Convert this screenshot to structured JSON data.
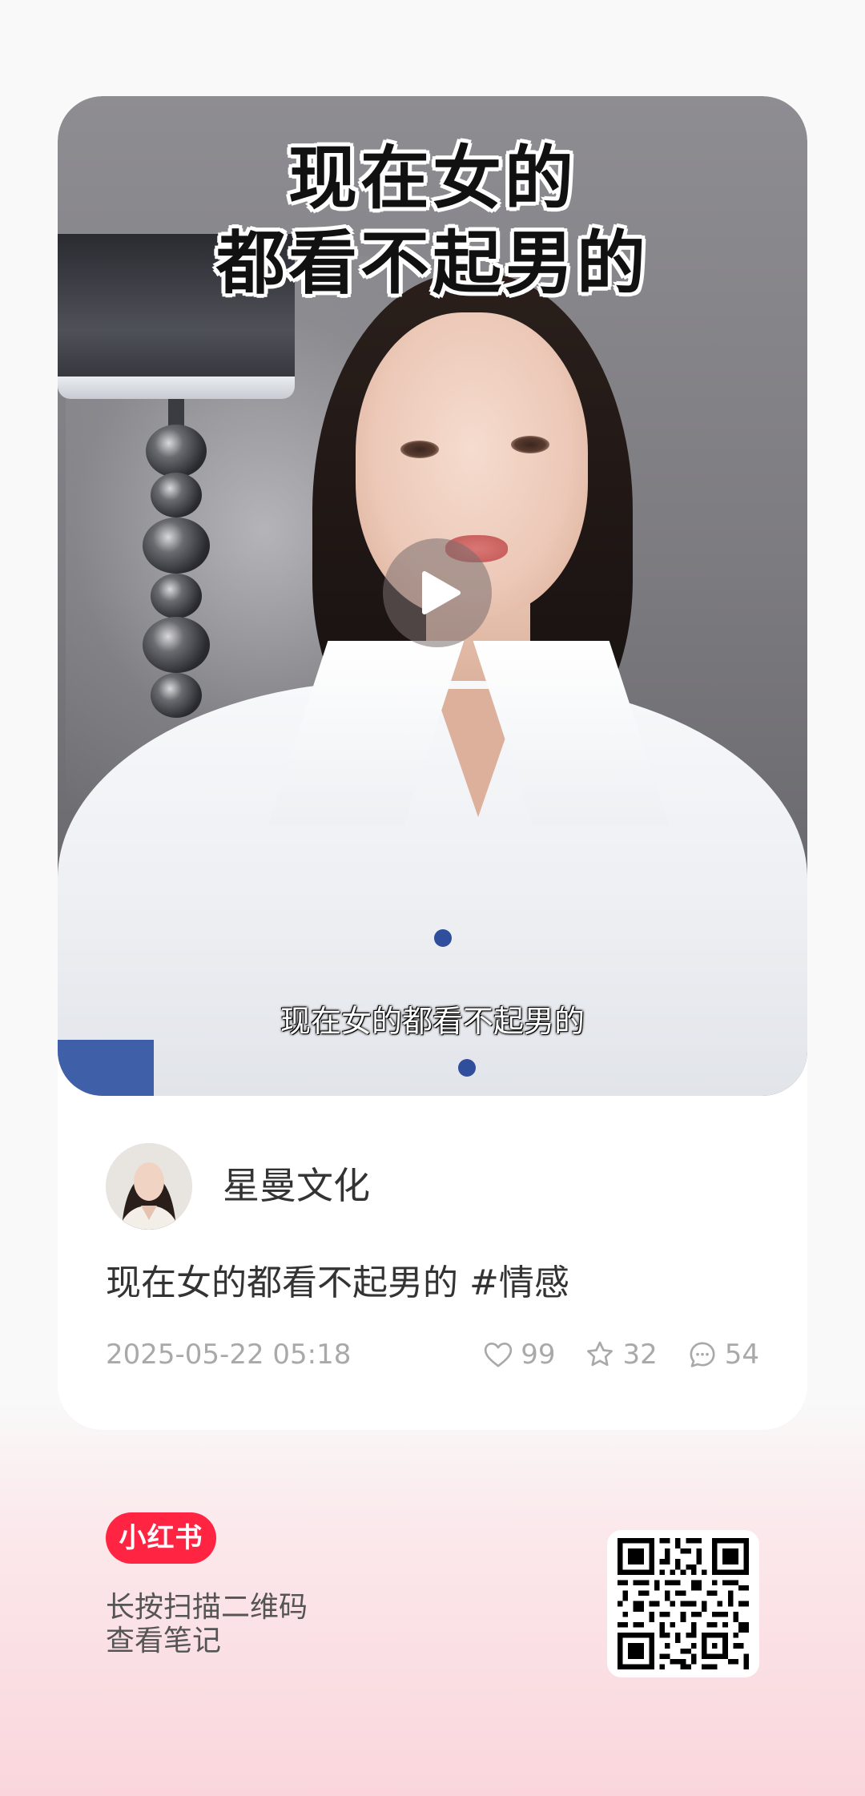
{
  "note": {
    "cover_title_line1": "现在女的",
    "cover_title_line2": "都看不起男的",
    "video_subtitle": "现在女的都看不起男的",
    "author_name": "星曼文化",
    "title": "现在女的都看不起男的 #情感",
    "date": "2025-05-22 05:18"
  },
  "stats": {
    "likes": "99",
    "collects": "32",
    "comments": "54"
  },
  "footer": {
    "brand": "小红书",
    "scan_line1": "长按扫描二维码",
    "scan_line2": "查看笔记"
  },
  "colors": {
    "brand": "#ff2442",
    "meta_text": "#a9a9a9",
    "primary_text": "#333333"
  },
  "icons": [
    "play-icon",
    "heart-icon",
    "star-icon",
    "comment-icon",
    "qr-code"
  ]
}
